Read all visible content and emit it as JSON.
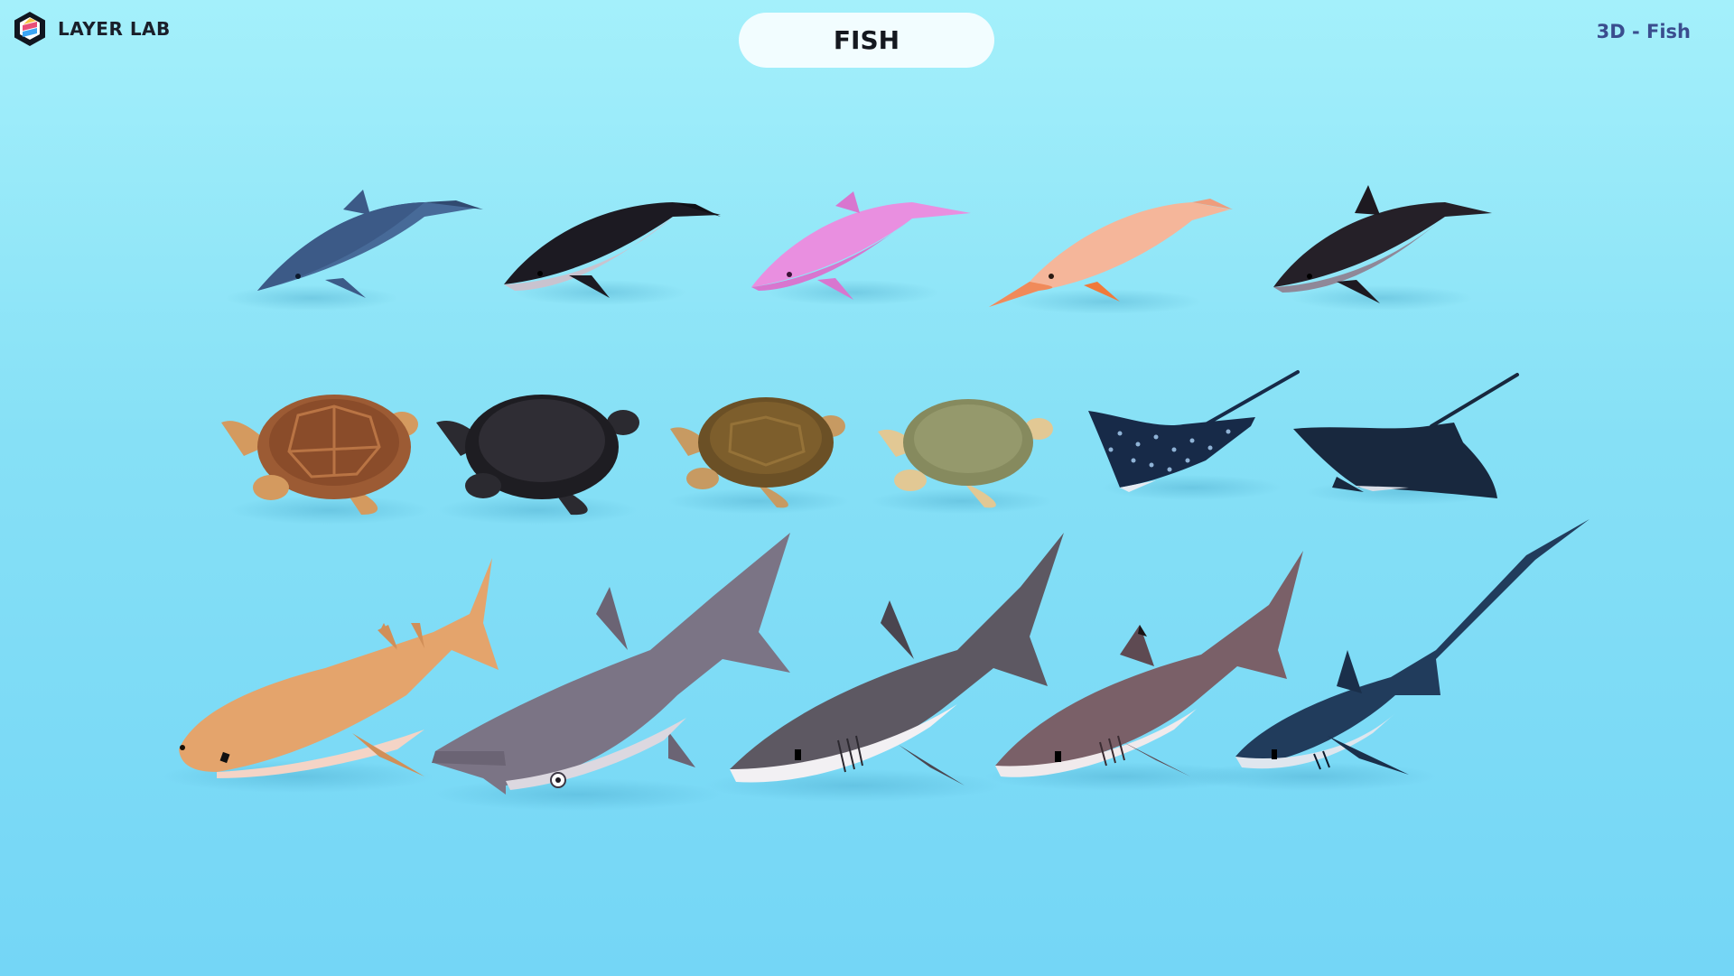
{
  "brand": {
    "logo_icon": "hexagon-layers-icon",
    "name": "LAYER LAB"
  },
  "header": {
    "title": "FISH",
    "subtitle": "3D - Fish"
  },
  "colors": {
    "background_top": "#a4f0fb",
    "background_bottom": "#74d6f6",
    "title_pill": "#f2fdff",
    "subtitle": "#3a4d8e"
  },
  "models": {
    "dolphins": [
      "dolphin-blue-icon",
      "dolphin-black-white-icon",
      "dolphin-pink-icon",
      "dolphin-peach-icon",
      "dolphin-dark-icon"
    ],
    "turtles_and_rays": [
      "turtle-brown-icon",
      "turtle-black-icon",
      "turtle-olive-icon",
      "turtle-pale-green-icon",
      "eagle-ray-spotted-icon",
      "stingray-dark-icon"
    ],
    "sharks": [
      "whale-shark-tan-icon",
      "hammerhead-shark-icon",
      "great-white-shark-icon",
      "reef-shark-icon",
      "thresher-shark-icon"
    ]
  }
}
